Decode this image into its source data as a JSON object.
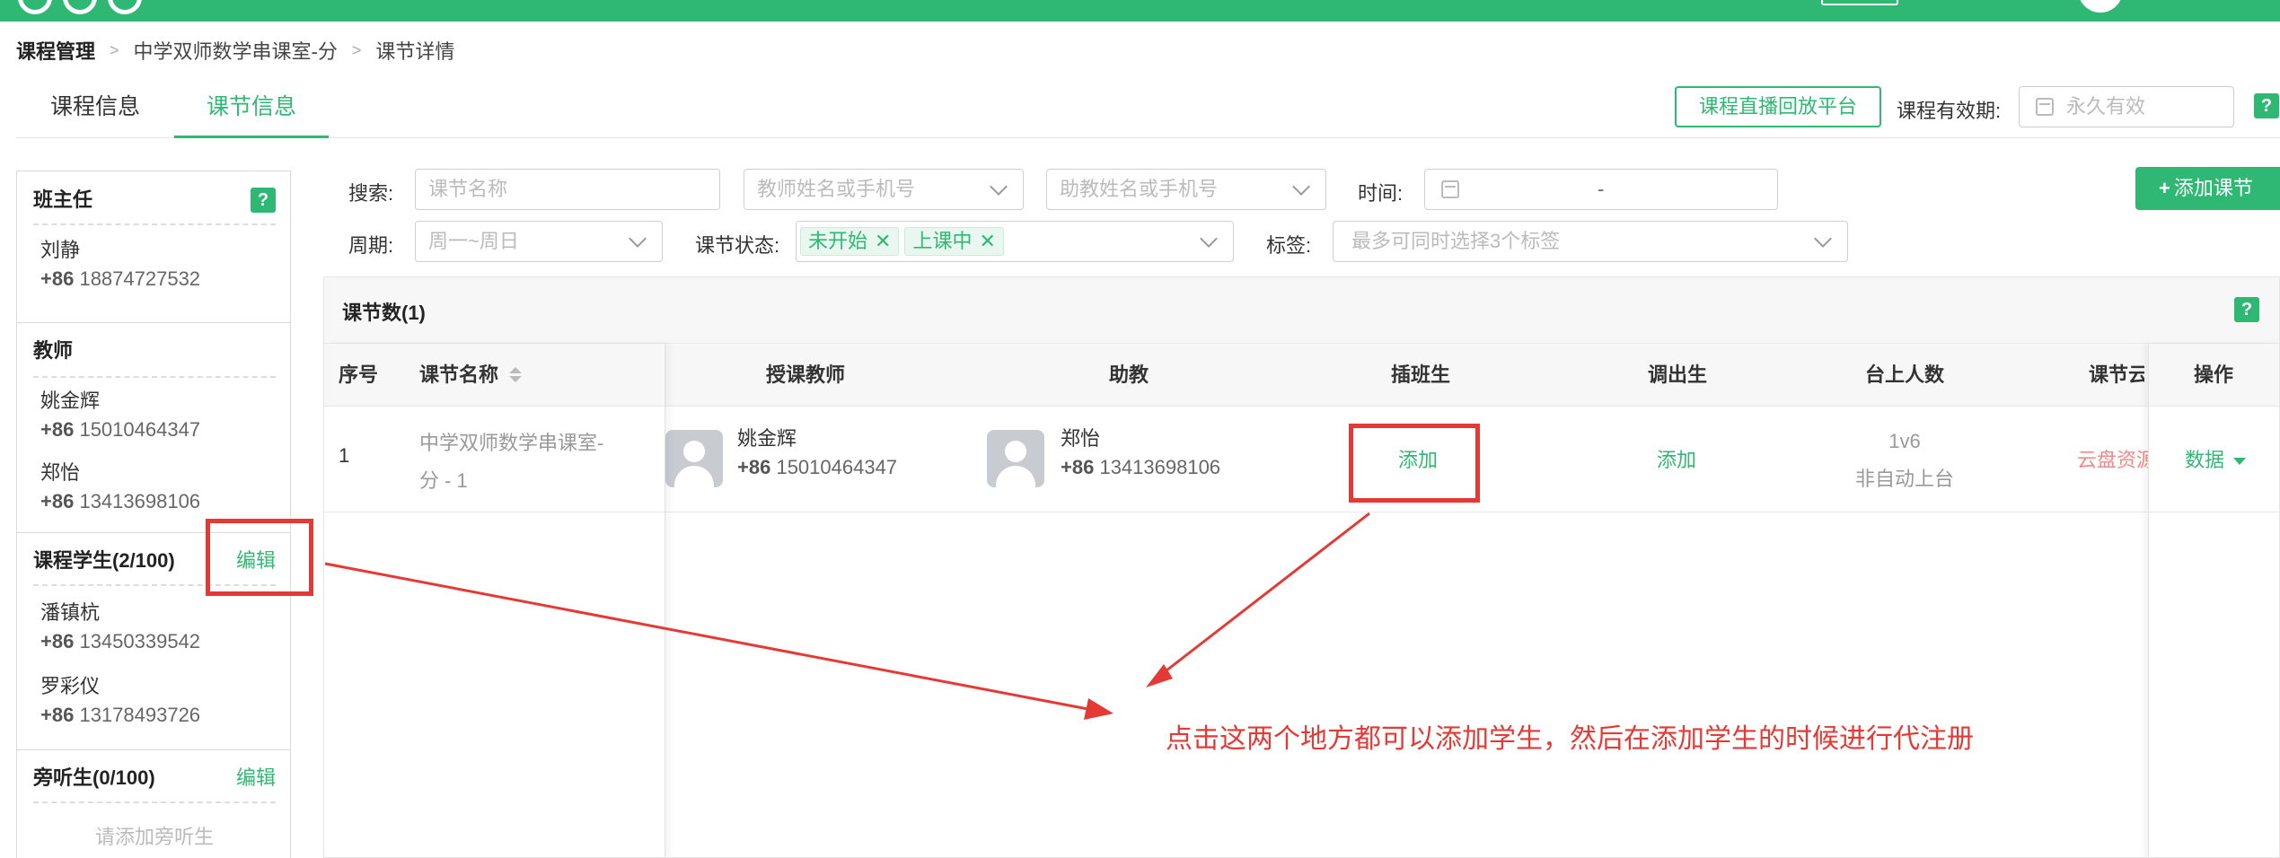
{
  "breadcrumb": [
    "课程管理",
    "中学双师数学串课室-分",
    "课节详情"
  ],
  "tabs": [
    "课程信息",
    "课节信息"
  ],
  "header": {
    "live_platform_button": "课程直播回放平台",
    "validity_label": "课程有效期:",
    "validity_value": "永久有效",
    "help": "?"
  },
  "sidebar": {
    "head_teacher": {
      "title": "班主任",
      "help": "?",
      "people": [
        {
          "name": "刘静",
          "cc": "+86",
          "phone": "18874727532"
        }
      ]
    },
    "teachers": {
      "title": "教师",
      "people": [
        {
          "name": "姚金辉",
          "cc": "+86",
          "phone": "15010464347"
        },
        {
          "name": "郑怡",
          "cc": "+86",
          "phone": "13413698106"
        }
      ]
    },
    "students": {
      "title": "课程学生(2/100)",
      "edit": "编辑",
      "people": [
        {
          "name": "潘镇杭",
          "cc": "+86",
          "phone": "13450339542"
        },
        {
          "name": "罗彩仪",
          "cc": "+86",
          "phone": "13178493726"
        }
      ]
    },
    "auditors": {
      "title": "旁听生(0/100)",
      "edit": "编辑",
      "empty": "请添加旁听生"
    }
  },
  "filters": {
    "search_label": "搜索:",
    "lesson_name_placeholder": "课节名称",
    "teacher_placeholder": "教师姓名或手机号",
    "assistant_placeholder": "助教姓名或手机号",
    "time_label": "时间:",
    "time_sep": "-",
    "cycle_label": "周期:",
    "cycle_placeholder": "周一~周日",
    "status_label": "课节状态:",
    "status_tags": [
      "未开始",
      "上课中"
    ],
    "tag_label": "标签:",
    "tag_placeholder": "最多可同时选择3个标签",
    "add_lesson_button": "添加课节"
  },
  "table": {
    "count_title": "课节数(1)",
    "help": "?",
    "columns": [
      "序号",
      "课节名称",
      "授课教师",
      "助教",
      "插班生",
      "调出生",
      "台上人数",
      "课节云盘",
      "操作"
    ],
    "rows": [
      {
        "index": "1",
        "name_line1": "中学双师数学串课室-",
        "name_line2": "分 - 1",
        "teacher_name": "姚金辉",
        "teacher_cc": "+86",
        "teacher_phone": "15010464347",
        "assistant_name": "郑怡",
        "assistant_cc": "+86",
        "assistant_phone": "13413698106",
        "insert_student": "添加",
        "transfer_student": "添加",
        "stage_count": "1v6",
        "stage_mode": "非自动上台",
        "cloud": "云盘资源",
        "action": "数据"
      }
    ]
  },
  "annotation": "点击这两个地方都可以添加学生，然后在添加学生的时候进行代注册",
  "colors": {
    "brand": "#2fb874",
    "annotation": "#e53935",
    "cloud_link": "#f08a8a"
  }
}
